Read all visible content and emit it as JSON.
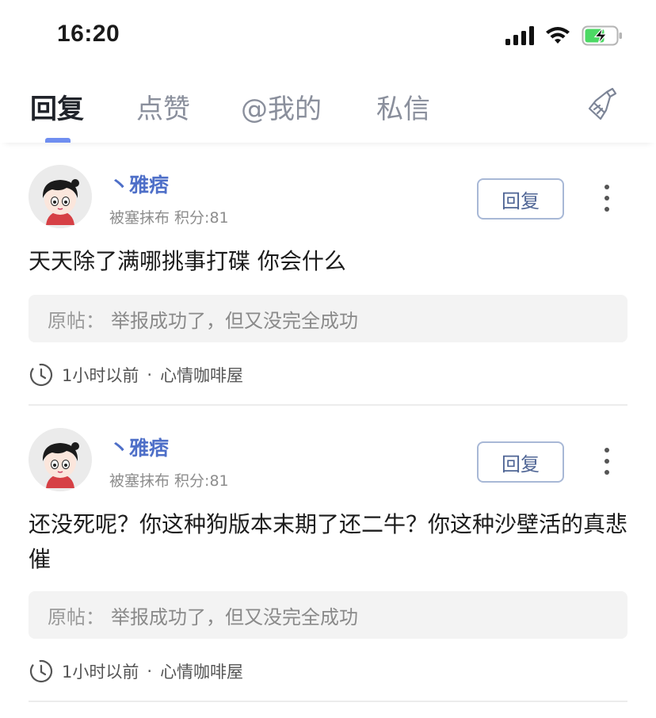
{
  "status_bar": {
    "time": "16:20"
  },
  "tabs": [
    {
      "label": "回复",
      "active": true
    },
    {
      "label": "点赞",
      "active": false
    },
    {
      "label": "@我的",
      "active": false
    },
    {
      "label": "私信",
      "active": false
    }
  ],
  "accent_color": "#6f8ef0",
  "username_color": "#4e6fc8",
  "battery_color": "#4cd964",
  "notifications": [
    {
      "username": "丶雅痞",
      "meta": "被塞抹布 积分:81",
      "reply_label": "回复",
      "content": "天天除了满哪挑事打碟 你会什么",
      "quote_label": "原帖：",
      "quote_text": "举报成功了，但又没完全成功",
      "time": "1小时以前",
      "separator": "·",
      "forum": "心情咖啡屋"
    },
    {
      "username": "丶雅痞",
      "meta": "被塞抹布 积分:81",
      "reply_label": "回复",
      "content": "还没死呢？你这种狗版本末期了还二牛？你这种沙壁活的真悲催",
      "quote_label": "原帖：",
      "quote_text": "举报成功了，但又没完全成功",
      "time": "1小时以前",
      "separator": "·",
      "forum": "心情咖啡屋"
    }
  ]
}
